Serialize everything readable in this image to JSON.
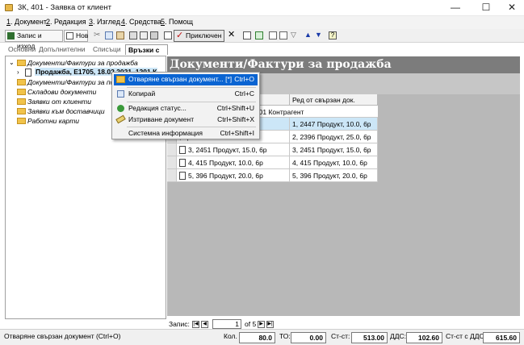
{
  "window": {
    "title": "3К, 401 - Заявка от клиент",
    "minimize": "—",
    "maximize": "☐",
    "close": "✕"
  },
  "menu": [
    {
      "key": "1",
      "label": ". Документ"
    },
    {
      "key": "2",
      "label": ". Редакция"
    },
    {
      "key": "3",
      "label": ". Изглед"
    },
    {
      "key": "4",
      "label": ". Средства"
    },
    {
      "key": "5",
      "label": ". Помощ"
    }
  ],
  "toolbar": {
    "save_exit": "Запис и изход",
    "new": "Нов",
    "post": "Приключен"
  },
  "tabs": [
    "Основни",
    "Допълнителни",
    "Списъци",
    "Връзки с документи"
  ],
  "tree": [
    "Документи/Фактури за продажба",
    "Продажба, Е1705, 18.02.2021, 1201 К",
    "Документи/Фактури за пок",
    "Складови документи",
    "Заявки от клиенти",
    "Заявки към доставчици",
    "Работни карти"
  ],
  "header": {
    "title": "Документи/Фактури за продажба"
  },
  "grid": {
    "col2_header": "Ред от свързан док.",
    "group_row": "ажба, Е1705, 18.02.2021, 1201 Контрагент",
    "rows": [
      {
        "c1": ", 6р",
        "c2": "1, 2447 Продукт, 10.0, 6р"
      },
      {
        "c1": ", 6р",
        "c2": "2, 2396 Продукт, 25.0, 6р"
      },
      {
        "c1": "3, 2451 Продукт, 15.0, 6р",
        "c2": "3, 2451 Продукт, 15.0, 6р"
      },
      {
        "c1": "4, 415 Продукт, 10.0, 6р",
        "c2": "4, 415 Продукт, 10.0, 6р"
      },
      {
        "c1": "5, 396 Продукт, 20.0, 6р",
        "c2": "5, 396 Продукт, 20.0, 6р"
      }
    ]
  },
  "context_menu": [
    {
      "label": "Отваряне свързан документ... [*]",
      "shortcut": "Ctrl+O"
    },
    {
      "label": "Копирай",
      "shortcut": "Ctrl+C"
    },
    {
      "label": "Редакция статус...",
      "shortcut": "Ctrl+Shift+U"
    },
    {
      "label": "Изтриване документ",
      "shortcut": "Ctrl+Shift+X"
    },
    {
      "label": "Системна информация",
      "shortcut": "Ctrl+Shift+I"
    }
  ],
  "nav": {
    "label": "Запис:",
    "current": "1",
    "of": "of 5"
  },
  "status": {
    "hint": "Отваряне свързан документ (Ctrl+O)",
    "qty_label": "Кол.",
    "qty": "80.0",
    "to_label": "ТО:",
    "to": "0.00",
    "value_label": "Ст-ст:",
    "value": "513.00",
    "vat_label": "ДДС:",
    "vat": "102.60",
    "total_label": "Ст-ст с ДДС:",
    "total": "615.60"
  }
}
